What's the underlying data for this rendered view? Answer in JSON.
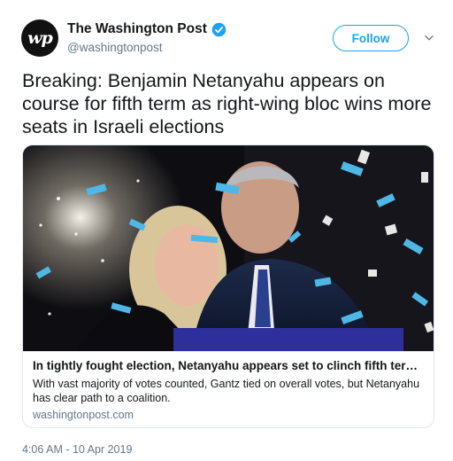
{
  "account": {
    "display_name": "The Washington Post",
    "handle": "@washingtonpost",
    "avatar_monogram": "wp",
    "verified": true
  },
  "header": {
    "follow_label": "Follow"
  },
  "tweet": {
    "text": "Breaking: Benjamin Netanyahu appears on course for fifth term as right-wing bloc wins more seats in Israeli elections",
    "timestamp": "4:06 AM - 10 Apr 2019"
  },
  "card": {
    "title": "In tightly fought election, Netanyahu appears set to clinch fifth term in of...",
    "description": "With vast majority of votes counted, Gantz tied on overall votes, but Netanyahu has clear path to a coalition.",
    "domain": "washingtonpost.com"
  },
  "colors": {
    "accent": "#1da1f2",
    "muted": "#657786",
    "text": "#14171a",
    "border": "#e1e8ed"
  }
}
